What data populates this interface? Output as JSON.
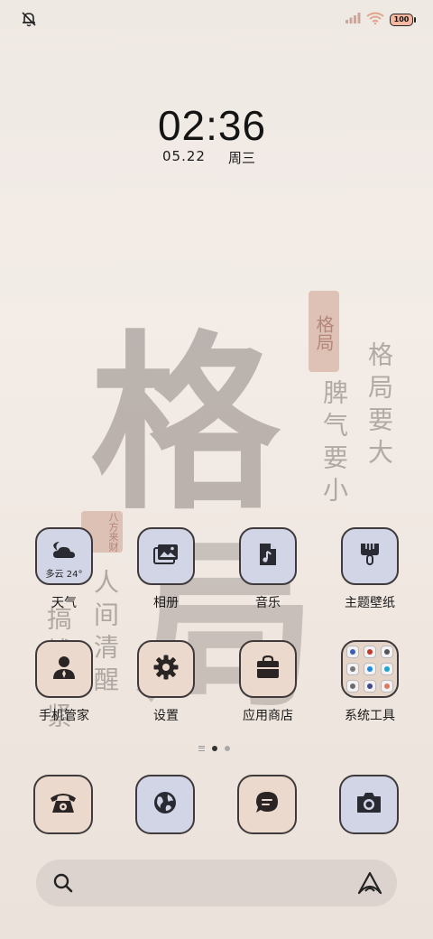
{
  "status_bar": {
    "left_icon": "bell-off-icon",
    "signal_icon": "signal-bars-icon",
    "wifi_icon": "wifi-icon",
    "battery_level": "100"
  },
  "clock": {
    "time": "02:36",
    "date": "05.22",
    "weekday": "周三"
  },
  "wallpaper": {
    "big_char_1": "格",
    "big_char_2": "局",
    "seal_text": "格局",
    "vertical_line_1": "格局要大",
    "vertical_line_2": "脾气要小",
    "vertical_line_3": "人间清醒",
    "vertical_line_4": "搞钱要紧",
    "small_seal": "八方来财"
  },
  "apps": {
    "row1": [
      {
        "label": "天气",
        "icon": "weather-cloud-moon-icon",
        "extra": "多云 24°"
      },
      {
        "label": "相册",
        "icon": "gallery-icon"
      },
      {
        "label": "音乐",
        "icon": "music-file-icon"
      },
      {
        "label": "主题壁纸",
        "icon": "paint-brush-icon"
      }
    ],
    "row2": [
      {
        "label": "手机管家",
        "icon": "manager-person-icon"
      },
      {
        "label": "设置",
        "icon": "gear-icon"
      },
      {
        "label": "应用商店",
        "icon": "shopping-bag-icon"
      },
      {
        "label": "系统工具",
        "icon": "folder-icon"
      }
    ]
  },
  "dock": [
    {
      "icon": "phone-icon"
    },
    {
      "icon": "browser-globe-icon"
    },
    {
      "icon": "message-icon"
    },
    {
      "icon": "camera-icon"
    }
  ],
  "search": {
    "search_icon": "search-icon",
    "assistant_icon": "ai-assistant-icon"
  },
  "colors": {
    "tile_blue": "#d1d5e6",
    "tile_beige": "#ead9cc",
    "tile_border": "#3f3a3c"
  }
}
